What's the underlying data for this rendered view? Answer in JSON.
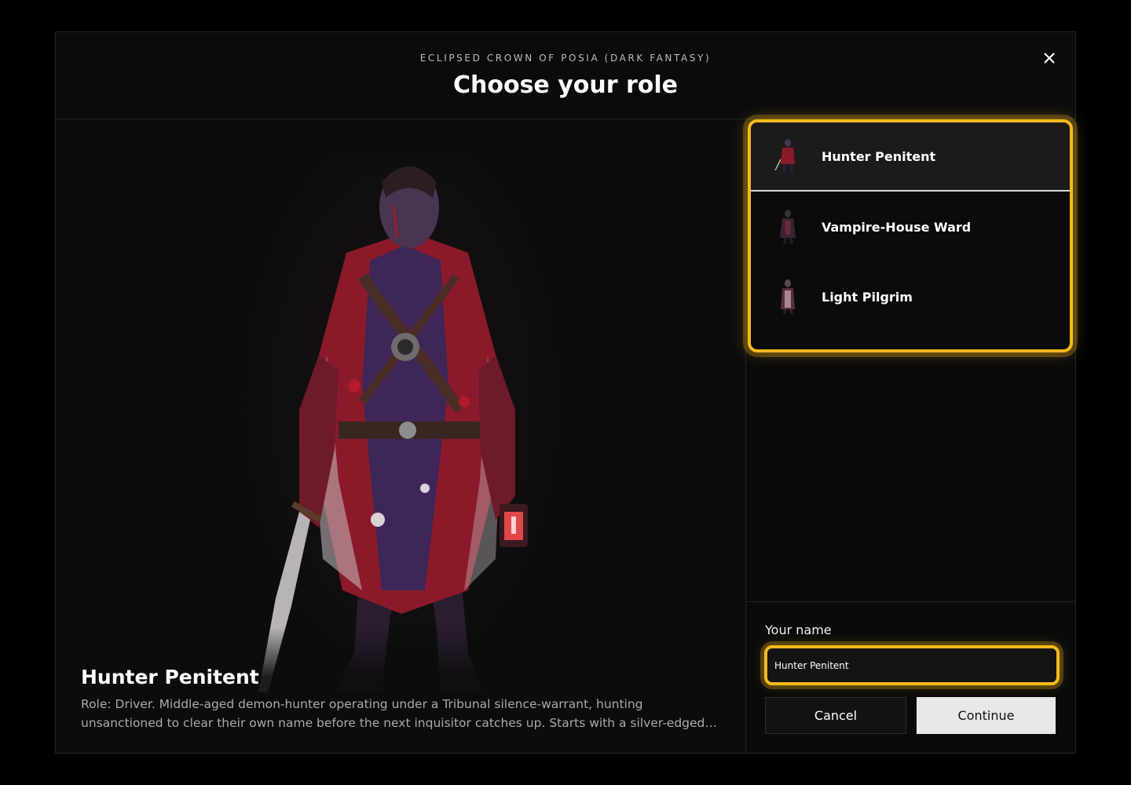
{
  "header": {
    "subtitle": "ECLIPSED CROWN OF POSIA (DARK FANTASY)",
    "title": "Choose your role",
    "close_icon": "close-icon"
  },
  "preview": {
    "name": "Hunter Penitent",
    "description": "Role: Driver. Middle-aged demon-hunter operating under a Tribunal silence-warrant, hunting unsanctioned to clear their own name before the next inquisitor catches up. Starts with a silver-edged blade, blood-fleck…"
  },
  "roles": [
    {
      "label": "Hunter Penitent",
      "selected": true
    },
    {
      "label": "Vampire-House Ward",
      "selected": false
    },
    {
      "label": "Light Pilgrim",
      "selected": false
    }
  ],
  "form": {
    "name_label": "Your name",
    "name_value": "Hunter Penitent",
    "cancel_label": "Cancel",
    "continue_label": "Continue"
  },
  "colors": {
    "accent": "#f6b91d",
    "background": "#0b0b0b"
  }
}
